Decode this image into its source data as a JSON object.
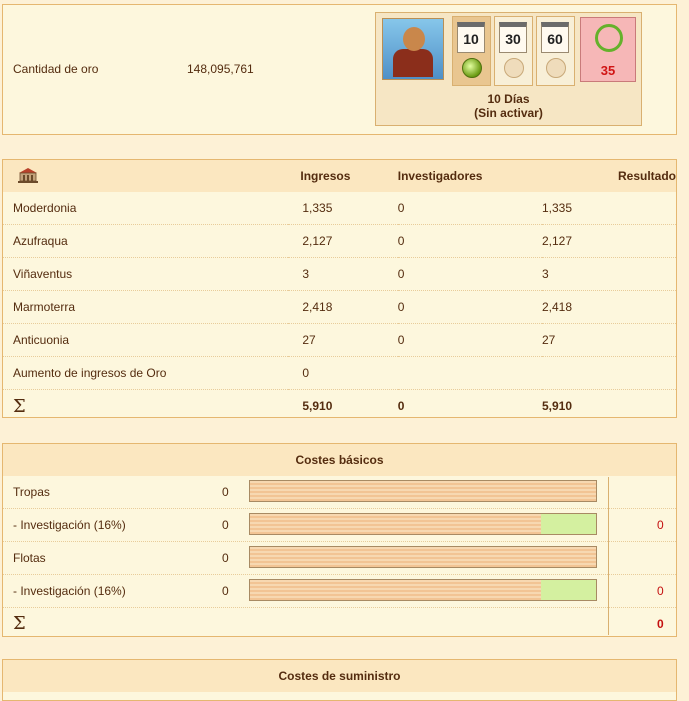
{
  "gold": {
    "label": "Cantidad de oro",
    "value": "148,095,761"
  },
  "premium": {
    "options": [
      {
        "days": "10",
        "selected": true
      },
      {
        "days": "30",
        "selected": false
      },
      {
        "days": "60",
        "selected": false
      }
    ],
    "bonus_value": "35",
    "status_line1": "10 Días",
    "status_line2": "(Sin activar)"
  },
  "income": {
    "header_icon": "town-hall-icon",
    "headers": [
      "Ingresos",
      "Investigadores",
      "Resultado"
    ],
    "rows": [
      {
        "name": "Moderdonia",
        "income": "1,335",
        "researchers": "0",
        "result": "1,335"
      },
      {
        "name": "Azufraqua",
        "income": "2,127",
        "researchers": "0",
        "result": "2,127"
      },
      {
        "name": "Viñaventus",
        "income": "3",
        "researchers": "0",
        "result": "3"
      },
      {
        "name": "Marmoterra",
        "income": "2,418",
        "researchers": "0",
        "result": "2,418"
      },
      {
        "name": "Anticuonia",
        "income": "27",
        "researchers": "0",
        "result": "27"
      }
    ],
    "boost_label": "Aumento de ingresos de Oro",
    "boost_value": "0",
    "total": {
      "symbol": "Σ",
      "income": "5,910",
      "researchers": "0",
      "result": "5,910"
    }
  },
  "basic_costs": {
    "title": "Costes básicos",
    "rows": [
      {
        "label": "Tropas",
        "value": "0",
        "result": "",
        "green_fraction": 0
      },
      {
        "label": "- Investigación (16%)",
        "value": "0",
        "result": "0",
        "green_fraction": 0.16
      },
      {
        "label": "Flotas",
        "value": "0",
        "result": "",
        "green_fraction": 0
      },
      {
        "label": "- Investigación (16%)",
        "value": "0",
        "result": "0",
        "green_fraction": 0.16
      }
    ],
    "total": {
      "symbol": "Σ",
      "value": "0"
    }
  },
  "supply_costs": {
    "title": "Costes de suministro"
  },
  "colors": {
    "result_red": "#c41010",
    "accent_green": "#6a9a12"
  }
}
